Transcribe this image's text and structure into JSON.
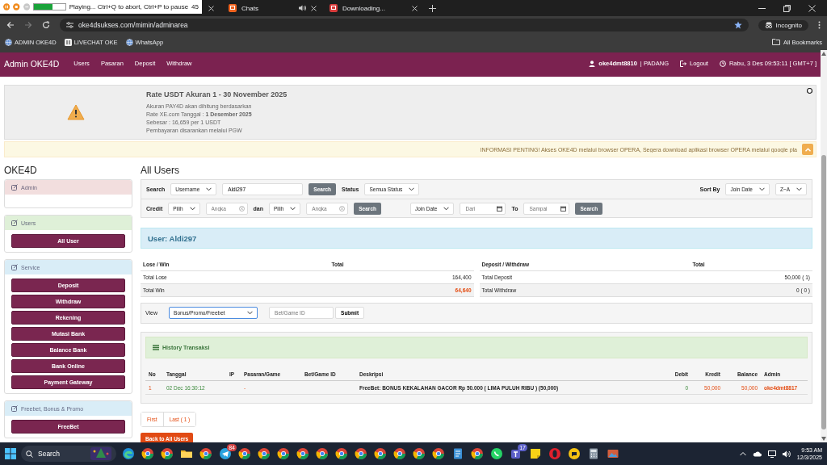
{
  "recorder": {
    "status": "Playing... Ctrl+Q to abort, Ctrl+P to pause",
    "level": 0.6,
    "extra": "45"
  },
  "tabs": [
    {
      "label": "Chats",
      "audio": true,
      "selected": false
    },
    {
      "label": "Downloading...",
      "audio": false,
      "selected": false
    }
  ],
  "address_bar": {
    "url": "oke4dsukses.com/mimin/adminarea",
    "mode": "Incognito"
  },
  "bookmarks": [
    {
      "label": "ADMIN OKE4D",
      "kind": "globe"
    },
    {
      "label": "LIVECHAT OKE",
      "kind": "chat"
    },
    {
      "label": "WhatsApp",
      "kind": "globe"
    }
  ],
  "all_bookmarks": "All Bookmarks",
  "navbar": {
    "brand": "Admin OKE4D",
    "links": [
      "Users",
      "Pasaran",
      "Deposit",
      "Withdraw"
    ],
    "user": "oke4dmt8810",
    "location": "| PADANG",
    "logout": "Logout",
    "clock": "Rabu, 3 Des 09:53:11 [ GMT+7 ]"
  },
  "notice": {
    "title": "Rate USDT Akuran 1 - 30 November 2025",
    "lines": [
      "Akuran PAY4D akan dihitung berdasarkan",
      "Rate XE.com Tanggal : **1 Desember 2025**",
      "Sebesar : 16,659 per 1 USDT",
      "Pembayaran disarankan melalui PGW"
    ]
  },
  "info_bar": "INFORMASI PENTING! Akses OKE4D melalui browser OPERA, Segera download aplikasi browser OPERA melalui google pla",
  "sidebar": {
    "title": "OKE4D",
    "panels": [
      {
        "title": "Admin",
        "color": "#f2dede"
      },
      {
        "title": "Users",
        "color": "#dff0d8",
        "items": [
          "All User"
        ]
      },
      {
        "title": "Service",
        "color": "#d9edf7",
        "items": [
          "Deposit",
          "Withdraw",
          "Rekening",
          "Mutasi Bank",
          "Balance Bank",
          "Bank Online",
          "Payment Gateway"
        ]
      },
      {
        "title": "Freebet, Bonus & Promo",
        "color": "#d9edf7",
        "items": [
          "FreeBet"
        ]
      }
    ]
  },
  "main": {
    "title": "All Users",
    "filters": [
      {
        "groups": [
          [
            {
              "kind": "label",
              "text": "Search"
            },
            {
              "kind": "select",
              "text": "Username"
            },
            {
              "kind": "text",
              "value": "Aldi297"
            },
            {
              "kind": "button",
              "text": "Search"
            },
            {
              "kind": "label",
              "text": "Status"
            },
            {
              "kind": "select",
              "text": "Semua Status"
            }
          ]
        ],
        "end": [
          {
            "kind": "label",
            "text": "Sort By"
          },
          {
            "kind": "select",
            "text": "Join Date"
          },
          {
            "kind": "select",
            "text": "Z~A"
          }
        ]
      },
      {
        "groups": [
          [
            {
              "kind": "label",
              "text": "Credit"
            },
            {
              "kind": "select",
              "text": "Pilih"
            },
            {
              "kind": "number",
              "placeholder": "Angka"
            },
            {
              "kind": "label",
              "text": "dan"
            },
            {
              "kind": "select",
              "text": "Pilih"
            },
            {
              "kind": "number",
              "placeholder": "Angka"
            },
            {
              "kind": "button",
              "text": "Search"
            }
          ],
          [
            {
              "kind": "select",
              "text": "Join Date"
            },
            {
              "kind": "date",
              "placeholder": "Dari"
            },
            {
              "kind": "label",
              "text": "To"
            },
            {
              "kind": "date",
              "placeholder": "Sampai"
            },
            {
              "kind": "button",
              "text": "Search"
            }
          ]
        ]
      }
    ],
    "user_heading": "User: Aldi297",
    "summaries": [
      {
        "columns": [
          "Lose / Win",
          "Total"
        ],
        "rows": [
          {
            "label": "Total Lose",
            "value": "164,400",
            "highlight": false
          },
          {
            "label": "Total Win",
            "value": "64,640",
            "highlight": true
          }
        ]
      },
      {
        "columns": [
          "Deposit / Withdraw",
          "Total"
        ],
        "rows": [
          {
            "label": "Total Deposit",
            "value": "50,000 ( 1)",
            "highlight": false
          },
          {
            "label": "Total Withdraw",
            "value": "0 ( 0 )",
            "highlight": false
          }
        ]
      }
    ],
    "view_bar": {
      "label": "View",
      "select": "Bonus/Promo/Freebet",
      "focused": true,
      "placeholder": "Bet/Game ID",
      "button": "Submit"
    },
    "history": {
      "title": "History Transaksi",
      "columns": [
        "No",
        "Tanggal",
        "IP",
        "Pasaran/Game",
        "Bet/Game ID",
        "Deskripsi",
        "Debit",
        "Kredit",
        "Balance",
        "Admin"
      ],
      "rows": [
        [
          "1",
          "02 Dec 16:30:12",
          null,
          "-",
          null,
          "FreeBet: BONUS KEKALAHAN GACOR Rp 50.000 ( LIMA PULUH RIBU ) (50,000)",
          "0",
          "50,000",
          "50,000",
          "oke4dmt8817"
        ]
      ]
    },
    "pagination": [
      "First",
      "Last ( 1 )"
    ],
    "back_button": "Back to All Users"
  },
  "taskbar": {
    "search": "Search",
    "apps": [
      {
        "kind": "edge"
      },
      {
        "kind": "chrome"
      },
      {
        "kind": "chrome"
      },
      {
        "kind": "folder"
      },
      {
        "kind": "chrome"
      },
      {
        "kind": "telegram",
        "badge": "84"
      },
      {
        "kind": "chrome"
      },
      {
        "kind": "chrome"
      },
      {
        "kind": "chrome"
      },
      {
        "kind": "chrome"
      },
      {
        "kind": "chrome"
      },
      {
        "kind": "chrome"
      },
      {
        "kind": "chrome"
      },
      {
        "kind": "chrome"
      },
      {
        "kind": "chrome"
      },
      {
        "kind": "chrome"
      },
      {
        "kind": "chrome"
      },
      {
        "kind": "notepad"
      },
      {
        "kind": "chrome"
      },
      {
        "kind": "whatsapp"
      },
      {
        "kind": "teams",
        "badge": "17"
      },
      {
        "kind": "sticky"
      },
      {
        "kind": "opera"
      },
      {
        "kind": "chat"
      },
      {
        "kind": "calculator"
      },
      {
        "kind": "photos"
      }
    ],
    "time": "9:53 AM",
    "date": "12/3/2025"
  }
}
